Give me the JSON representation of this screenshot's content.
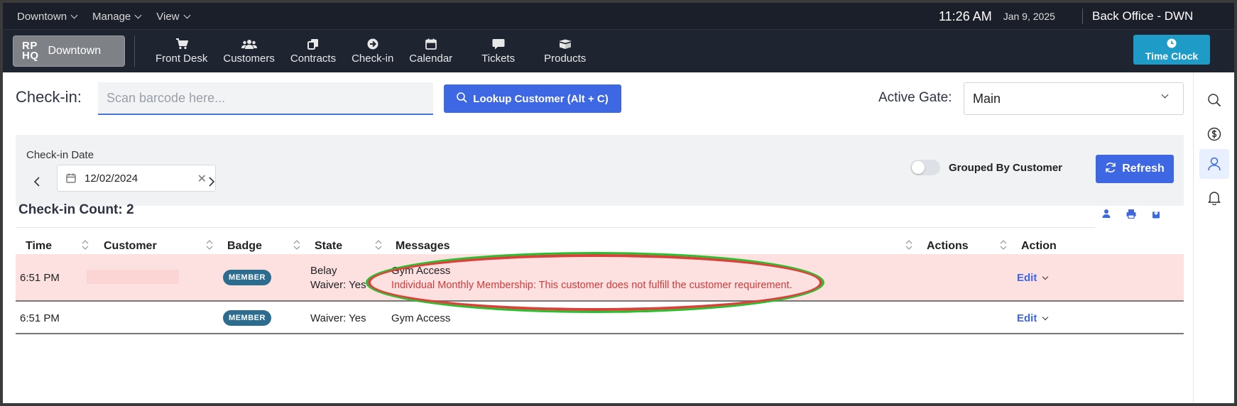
{
  "topmenu": {
    "items": [
      {
        "label": "Downtown"
      },
      {
        "label": "Manage"
      },
      {
        "label": "View"
      }
    ],
    "time": "11:26 AM",
    "date": "Jan 9, 2025",
    "office": "Back Office - DWN"
  },
  "navbar": {
    "logo": "RP HQ",
    "logo_line1": "RP",
    "logo_line2": "HQ",
    "location": "Downtown",
    "items": [
      {
        "label": "Front Desk",
        "icon": "cart-icon"
      },
      {
        "label": "Customers",
        "icon": "users-icon"
      },
      {
        "label": "Contracts",
        "icon": "contracts-icon"
      },
      {
        "label": "Check-in",
        "icon": "arrow-circle-icon"
      },
      {
        "label": "Calendar",
        "icon": "calendar-icon"
      },
      {
        "label": "Tickets",
        "icon": "chat-icon"
      },
      {
        "label": "Products",
        "icon": "box-icon"
      }
    ],
    "time_clock": "Time Clock"
  },
  "checkin": {
    "label": "Check-in:",
    "placeholder": "Scan barcode here...",
    "lookup_label": "Lookup Customer (Alt + C)",
    "active_gate_label": "Active Gate:",
    "active_gate_value": "Main"
  },
  "filter": {
    "date_label": "Check-in Date",
    "date_value": "12/02/2024",
    "grouped_label": "Grouped By Customer",
    "refresh_label": "Refresh"
  },
  "table": {
    "count_label": "Check-in Count: 2",
    "columns": [
      "Time",
      "Customer",
      "Badge",
      "State",
      "Messages",
      "Actions",
      "Action"
    ],
    "rows": [
      {
        "time": "6:51 PM",
        "customer": "",
        "badge": "MEMBER",
        "state_1": "Belay",
        "state_2": "Waiver: Yes",
        "message_1": "Gym Access",
        "message_2": "Individual Monthly Membership: This customer does not fulfill the customer requirement.",
        "action": "Edit"
      },
      {
        "time": "6:51 PM",
        "customer": "",
        "badge": "MEMBER",
        "state_1": "Waiver: Yes",
        "message_1": "Gym Access",
        "action": "Edit"
      }
    ]
  },
  "colors": {
    "primary": "#3d67e3",
    "navbar": "#1e2530",
    "error_row": "#fde0e0",
    "error_text": "#d33b3b",
    "badge": "#2c6d8f",
    "time_clock": "#1f9bc7"
  }
}
